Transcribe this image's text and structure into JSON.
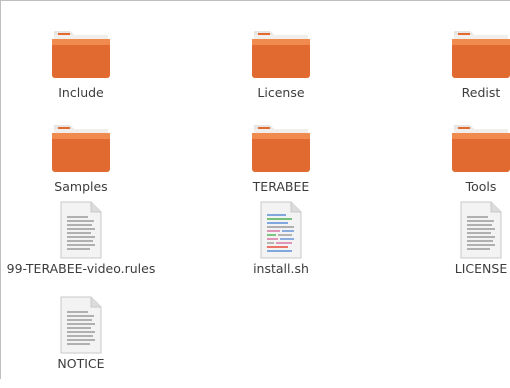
{
  "colors": {
    "folder_light": "#f08a4f",
    "folder_dark": "#d95a23",
    "folder_tab": "#e7e4df",
    "label": "#3c3c3c",
    "border": "#bfbfbf"
  },
  "files": [
    {
      "label": "Include",
      "type": "folder"
    },
    {
      "label": "License",
      "type": "folder"
    },
    {
      "label": "Redist",
      "type": "folder"
    },
    {
      "label": "Samples",
      "type": "folder"
    },
    {
      "label": "TERABEE",
      "type": "folder"
    },
    {
      "label": "Tools",
      "type": "folder"
    },
    {
      "label": "99-TERABEE-video.rules",
      "type": "text-file"
    },
    {
      "label": "install.sh",
      "type": "script-file"
    },
    {
      "label": "LICENSE",
      "type": "text-file"
    },
    {
      "label": "NOTICE",
      "type": "text-file"
    }
  ]
}
